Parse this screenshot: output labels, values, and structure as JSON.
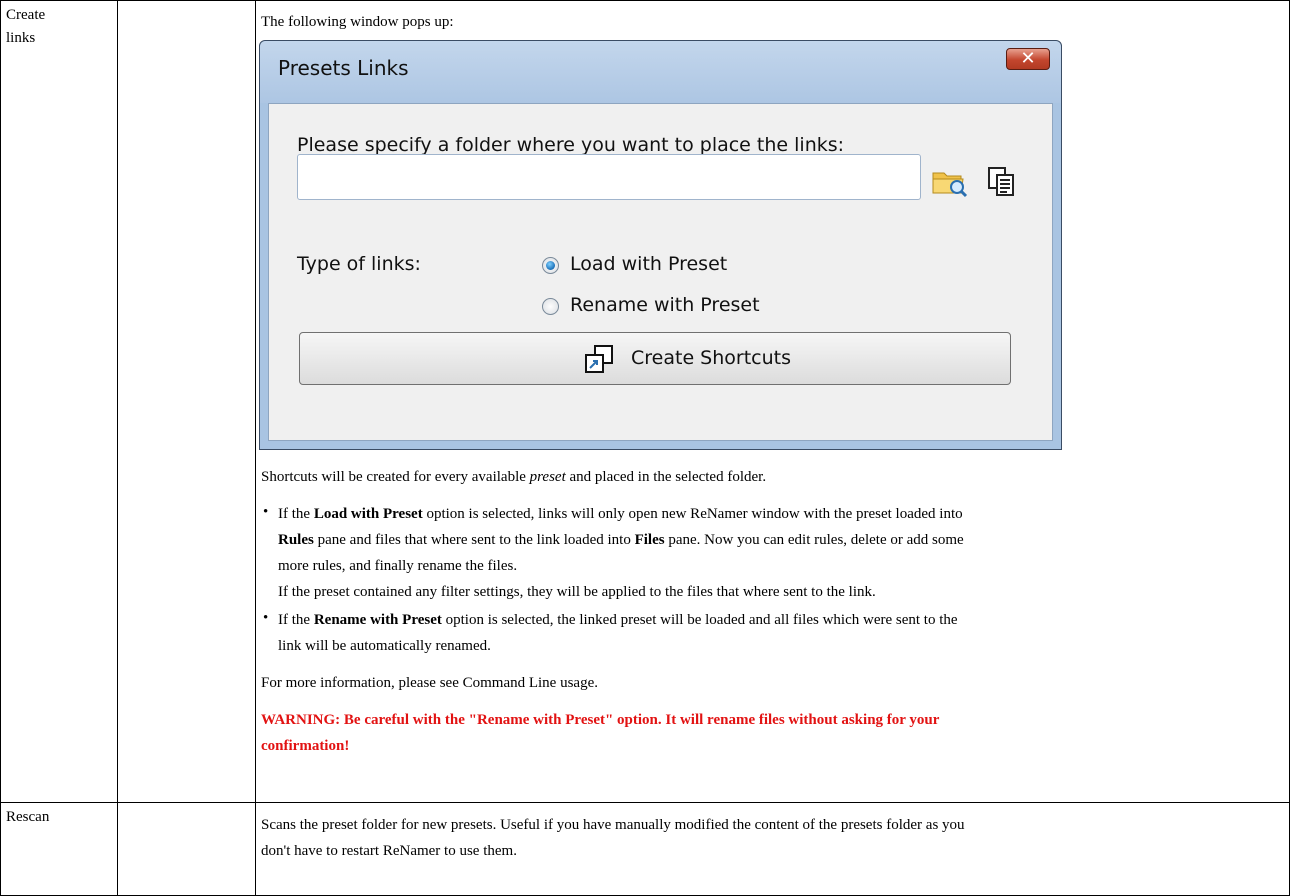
{
  "table": {
    "rows": [
      {
        "col1": [
          "Create",
          "links"
        ],
        "col2": ""
      },
      {
        "col1": [
          "Rescan"
        ],
        "col2": ""
      }
    ]
  },
  "content": {
    "intro": "The following window pops up:",
    "shortcuts_text_a": "Shortcuts will be created for every available ",
    "shortcuts_text_em": "preset",
    "shortcuts_text_b": " and placed in the selected folder.",
    "bullet1": {
      "l1_a": "If the ",
      "l1_b": "Load with Preset",
      "l1_c": " option is selected, links will only open new ReNamer window with the preset loaded into",
      "l2_a": "Rules",
      "l2_b": " pane and files that where sent to the link loaded into ",
      "l2_c": "Files",
      "l2_d": " pane. Now you can edit rules, delete or add some",
      "l3": "more rules, and finally rename the files.",
      "l4": "If the preset contained any filter settings, they will be applied to the files that where sent to the link."
    },
    "bullet2": {
      "l1_a": "If the ",
      "l1_b": "Rename with Preset",
      "l1_c": " option is selected, the linked preset will be loaded and all files which were sent to the",
      "l2": "link will be automatically renamed."
    },
    "more_info": "For more information, please see Command Line usage.",
    "warning_l1": "WARNING: Be careful with the \"Rename with Preset\" option. It will rename files without asking for your",
    "warning_l2": "confirmation!",
    "rescan_l1": "Scans the preset folder for new presets. Useful if you have manually modified the content of the presets folder as you",
    "rescan_l2": "don't have to restart ReNamer to use them."
  },
  "dialog": {
    "title": "Presets Links",
    "close_glyph": "✕",
    "folder_prompt": "Please specify a folder where you want to place the links:",
    "folder_value": "",
    "type_label": "Type of links:",
    "options": [
      {
        "label": "Load with Preset",
        "checked": true
      },
      {
        "label": "Rename with Preset",
        "checked": false
      }
    ],
    "button_label": "Create Shortcuts"
  },
  "colors": {
    "warning": "#e21212",
    "window_frame": "#a9c4e2",
    "close_button": "#c3462e"
  },
  "icons": [
    "browse-folder-icon",
    "clipboard-icon",
    "shortcut-icon",
    "bullet-icon"
  ]
}
